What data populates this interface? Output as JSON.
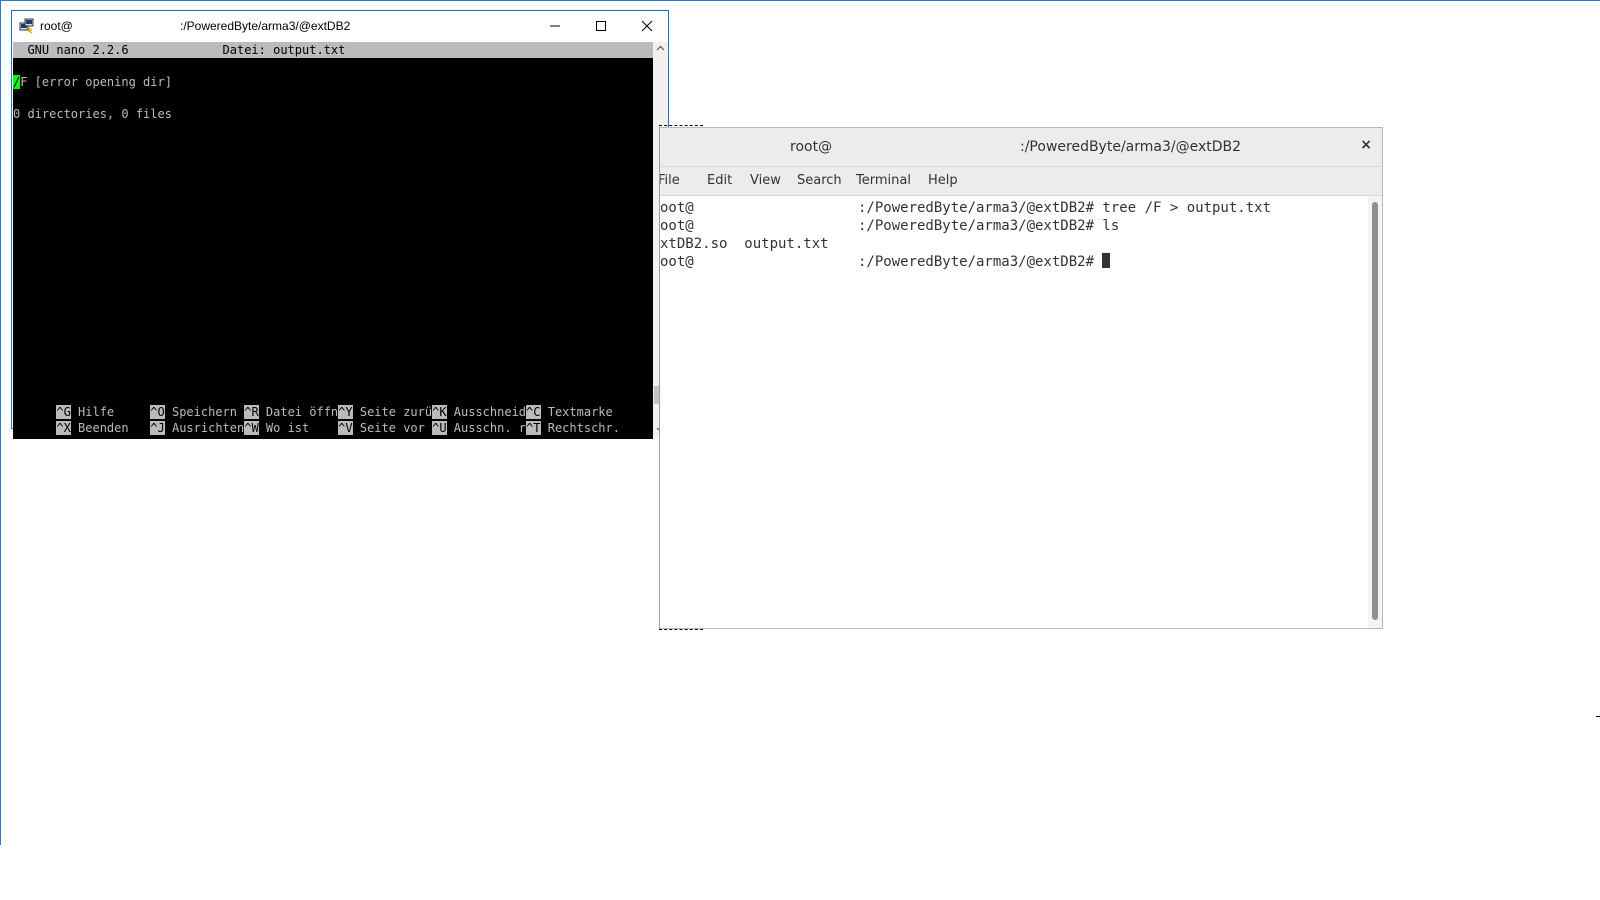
{
  "putty": {
    "title_user": "root@",
    "title_path": ":/PoweredByte/arma3/@extDB2",
    "nano_version": "GNU nano 2.2.6",
    "nano_file": "Datei: output.txt",
    "content_line1_cursor": "/",
    "content_line1_rest": "F [error opening dir]",
    "content_line2": "0 directories, 0 files",
    "shortcuts_row1": [
      {
        "key": "^G",
        "label": " Hilfe     "
      },
      {
        "key": "^O",
        "label": " Speichern "
      },
      {
        "key": "^R",
        "label": " Datei öffn"
      },
      {
        "key": "^Y",
        "label": " Seite zurü"
      },
      {
        "key": "^K",
        "label": " Ausschneid"
      },
      {
        "key": "^C",
        "label": " Textmarke"
      }
    ],
    "shortcuts_row2": [
      {
        "key": "^X",
        "label": " Beenden   "
      },
      {
        "key": "^J",
        "label": " Ausrichten"
      },
      {
        "key": "^W",
        "label": " Wo ist    "
      },
      {
        "key": "^V",
        "label": " Seite vor "
      },
      {
        "key": "^U",
        "label": " Ausschn. r"
      },
      {
        "key": "^T",
        "label": " Rechtschr."
      }
    ]
  },
  "gterm": {
    "title_user": "root@",
    "title_path": ":/PoweredByte/arma3/@extDB2",
    "close_glyph": "×",
    "menu": [
      "File",
      "Edit",
      "View",
      "Search",
      "Terminal",
      "Help"
    ],
    "lines": [
      {
        "left": "oot@",
        "right": ":/PoweredByte/arma3/@extDB2# tree /F > output.txt"
      },
      {
        "left": "oot@",
        "right": ":/PoweredByte/arma3/@extDB2# ls"
      },
      {
        "left": "xtDB2.so  output.txt",
        "right": ""
      },
      {
        "left": "oot@",
        "right": ":/PoweredByte/arma3/@extDB2# "
      }
    ]
  },
  "colors": {
    "putty_border": "#1e73c8",
    "terminal_bg": "#000000",
    "terminal_fg": "#bbbbbb",
    "cursor": "#00ff00"
  },
  "icons": {
    "putty_app": "putty-app-icon",
    "minimize": "minimize-icon",
    "maximize": "maximize-icon",
    "close": "close-icon"
  }
}
